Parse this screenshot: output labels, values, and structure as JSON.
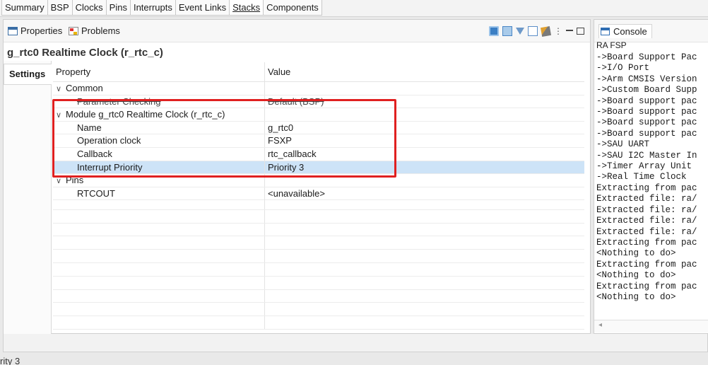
{
  "top_tabs": [
    {
      "label": "Summary"
    },
    {
      "label": "BSP"
    },
    {
      "label": "Clocks"
    },
    {
      "label": "Pins"
    },
    {
      "label": "Interrupts"
    },
    {
      "label": "Event Links"
    },
    {
      "label": "Stacks"
    },
    {
      "label": "Components"
    }
  ],
  "active_top_tab": "Stacks",
  "panel": {
    "tab_properties": "Properties",
    "tab_problems": "Problems",
    "toolbar_menu_glyph": "⋮"
  },
  "title": "g_rtc0 Realtime Clock (r_rtc_c)",
  "side_tab": "Settings",
  "table": {
    "header_property": "Property",
    "header_value": "Value",
    "rows": [
      {
        "property": "Common",
        "value": "",
        "expander": "∨"
      },
      {
        "property": "Parameter Checking",
        "value": "Default (BSP)"
      },
      {
        "property": "Module g_rtc0 Realtime Clock (r_rtc_c)",
        "value": "",
        "expander": "∨"
      },
      {
        "property": "Name",
        "value": "g_rtc0"
      },
      {
        "property": "Operation clock",
        "value": "FSXP"
      },
      {
        "property": "Callback",
        "value": "rtc_callback"
      },
      {
        "property": "Interrupt Priority",
        "value": "Priority 3"
      },
      {
        "property": "Pins",
        "value": "",
        "expander": "∨"
      },
      {
        "property": "RTCOUT",
        "value": "<unavailable>"
      }
    ]
  },
  "console": {
    "tab_label": "Console",
    "header": "RA FSP",
    "lines": [
      "->Board Support Pac",
      "->I/O Port",
      "->Arm CMSIS Version",
      "->Custom Board Supp",
      "->Board support pac",
      "->Board support pac",
      "->Board support pac",
      "->Board support pac",
      "->SAU UART",
      "->SAU I2C Master In",
      "->Timer Array Unit",
      "->Real Time Clock",
      "Extracting from pac",
      "Extracted file: ra/",
      "Extracted file: ra/",
      "Extracted file: ra/",
      "Extracted file: ra/",
      "Extracting from pac",
      "<Nothing to do>",
      "Extracting from pac",
      "<Nothing to do>",
      "Extracting from pac",
      "<Nothing to do>"
    ],
    "scroll_left_glyph": "◂"
  },
  "bottom_text": "rity 3",
  "colors": {
    "highlight_box": "#e02020",
    "selected_row": "#cde3f7"
  }
}
